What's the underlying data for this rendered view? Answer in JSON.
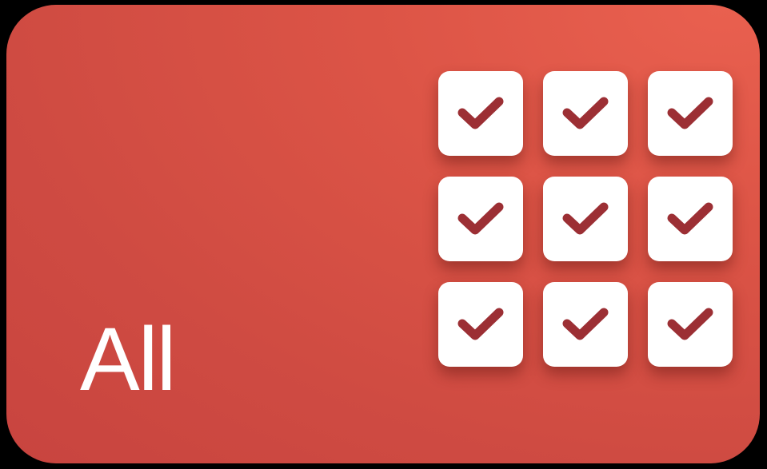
{
  "card": {
    "title": "All",
    "background_color": "#d44f44",
    "tile_icon": "checkmark-icon",
    "check_color": "#9c2f34",
    "tiles": [
      {
        "icon": "checkmark-icon",
        "checked": true
      },
      {
        "icon": "checkmark-icon",
        "checked": true
      },
      {
        "icon": "checkmark-icon",
        "checked": true
      },
      {
        "icon": "checkmark-icon",
        "checked": true
      },
      {
        "icon": "checkmark-icon",
        "checked": true
      },
      {
        "icon": "checkmark-icon",
        "checked": true
      },
      {
        "icon": "checkmark-icon",
        "checked": true
      },
      {
        "icon": "checkmark-icon",
        "checked": true
      },
      {
        "icon": "checkmark-icon",
        "checked": true
      }
    ]
  }
}
